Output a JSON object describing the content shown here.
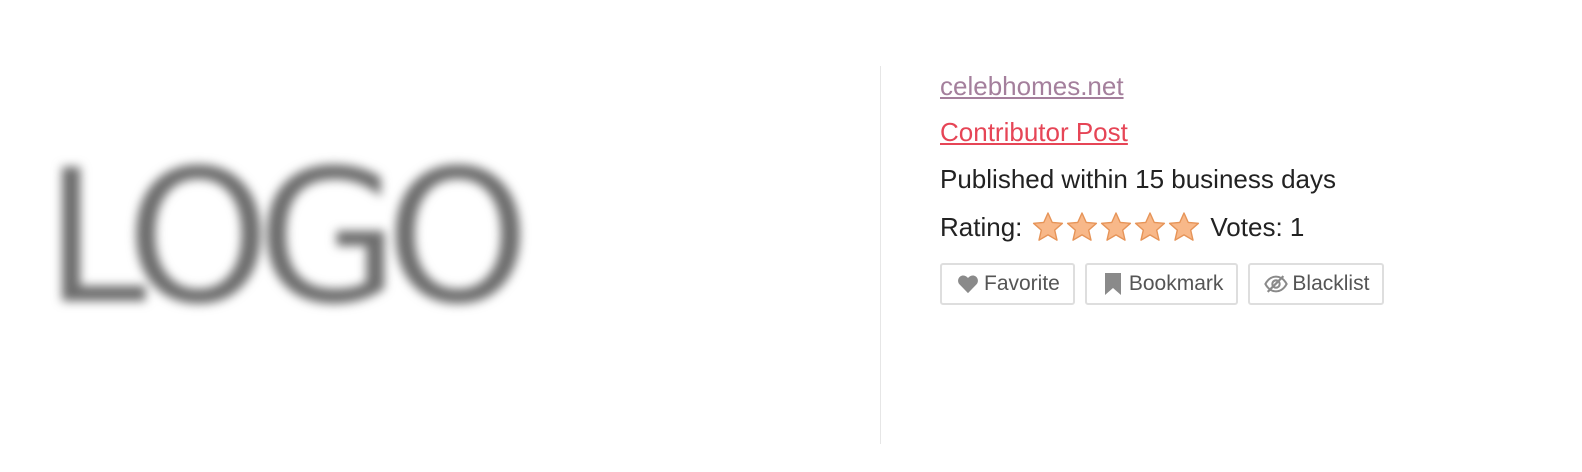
{
  "logo": {
    "text": "LOGO"
  },
  "listing": {
    "site_name": "celebhomes.net",
    "post_type": "Contributor Post",
    "publish_time": "Published within 15 business days",
    "rating_label": "Rating:",
    "rating_value": 5,
    "rating_max": 5,
    "votes_label": "Votes: 1"
  },
  "actions": {
    "favorite_label": "Favorite",
    "bookmark_label": "Bookmark",
    "blacklist_label": "Blacklist"
  },
  "colors": {
    "site_link": "#a47f9c",
    "post_type": "#e64556",
    "star_fill": "#f8b889",
    "star_stroke": "#e69458",
    "button_border": "#dedede",
    "icon": "#8a8a8a"
  },
  "icons": {
    "favorite": "heart-icon",
    "bookmark": "bookmark-icon",
    "blacklist": "eye-slash-icon",
    "rating": "star-icon"
  }
}
